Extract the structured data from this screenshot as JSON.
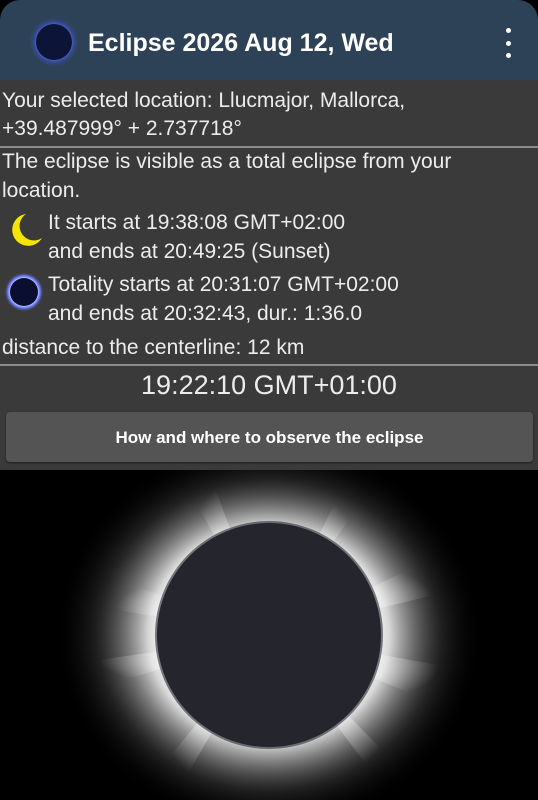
{
  "app_bar": {
    "title": "Eclipse 2026 Aug 12, Wed",
    "app_icon": "eclipse-app-icon",
    "menu_icon": "overflow-menu-icon"
  },
  "location": {
    "line1": "Your selected location: Llucmajor, Mallorca,",
    "line2": "+39.487999°  + 2.737718°"
  },
  "visibility": {
    "line1": "The eclipse is visible as a total eclipse from your",
    "line2": "location."
  },
  "partial": {
    "icon": "crescent-moon-icon",
    "starts": "It starts at 19:38:08 GMT+02:00",
    "ends": "and ends at 20:49:25 (Sunset)"
  },
  "totality": {
    "icon": "total-eclipse-icon",
    "starts": "Totality starts at 20:31:07 GMT+02:00",
    "ends": "and ends at 20:32:43, dur.:  1:36.0"
  },
  "centerline": {
    "text": " distance to the centerline: 12 km"
  },
  "current_time": "19:22:10 GMT+01:00",
  "observe_button": {
    "label": "How and where to observe the eclipse"
  },
  "colors": {
    "app_bar": "#2d4256",
    "panel": "#3a3a3a",
    "button": "#545454",
    "moon_disc": "#25252e",
    "crescent": "#f5e600"
  }
}
